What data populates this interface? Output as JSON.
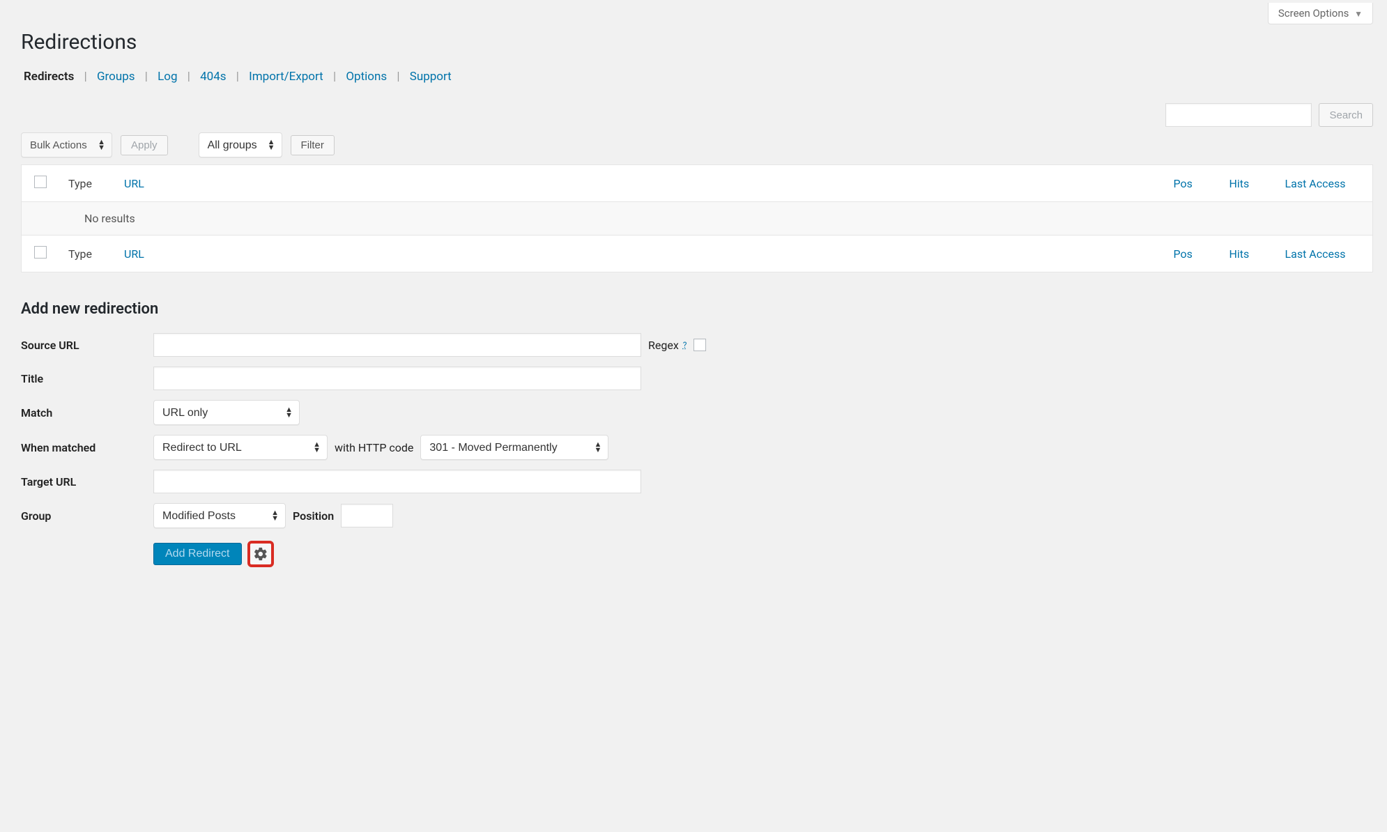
{
  "screenOptions": "Screen Options",
  "pageTitle": "Redirections",
  "nav": {
    "redirects": "Redirects",
    "groups": "Groups",
    "log": "Log",
    "fourohfour": "404s",
    "importExport": "Import/Export",
    "options": "Options",
    "support": "Support"
  },
  "searchBtn": "Search",
  "bulk": {
    "label": "Bulk Actions",
    "apply": "Apply"
  },
  "groupFilter": {
    "label": "All groups",
    "filterBtn": "Filter"
  },
  "table": {
    "colType": "Type",
    "colURL": "URL",
    "colPos": "Pos",
    "colHits": "Hits",
    "colLast": "Last Access",
    "empty": "No results"
  },
  "addSection": {
    "title": "Add new redirection",
    "sourceUrl": "Source URL",
    "regex": "Regex",
    "titleLabel": "Title",
    "match": "Match",
    "matchSel": "URL only",
    "whenMatched": "When matched",
    "whenMatchedSel": "Redirect to URL",
    "httpCodeLabel": "with HTTP code",
    "httpCodeSel": "301 - Moved Permanently",
    "targetUrl": "Target URL",
    "group": "Group",
    "groupSel": "Modified Posts",
    "position": "Position",
    "addBtn": "Add Redirect"
  }
}
